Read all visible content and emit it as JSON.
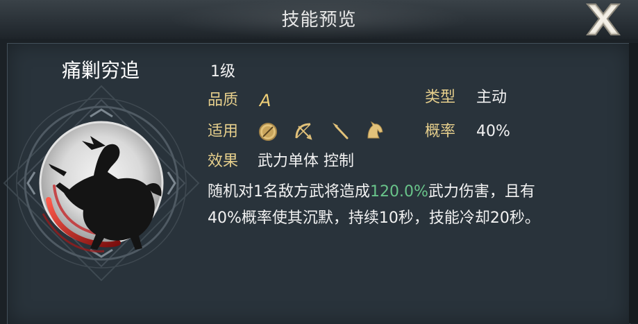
{
  "header": {
    "title": "技能预览"
  },
  "skill": {
    "name": "痛剿穷追",
    "level": "1级",
    "quality_label": "品质",
    "quality_value": "A",
    "type_label": "类型",
    "type_value": "主动",
    "applicable_label": "适用",
    "applicable_icons": [
      "shield-icon",
      "bow-icon",
      "spear-icon",
      "horse-icon"
    ],
    "rate_label": "概率",
    "rate_value": "40%",
    "effect_label": "效果",
    "effect_value": "武力单体 控制",
    "description": {
      "line1_pre": "随机对1名敌方武将造成",
      "line1_highlight": "120.0%",
      "line1_post": "武力伤害，且有",
      "line2": "40%概率使其沉默，持续10秒，技能冷却20秒。"
    }
  },
  "colors": {
    "label": "#e6cf8c",
    "highlight": "#69c48a",
    "panel": "#29333b",
    "icon_gold": "#e2c27a"
  }
}
